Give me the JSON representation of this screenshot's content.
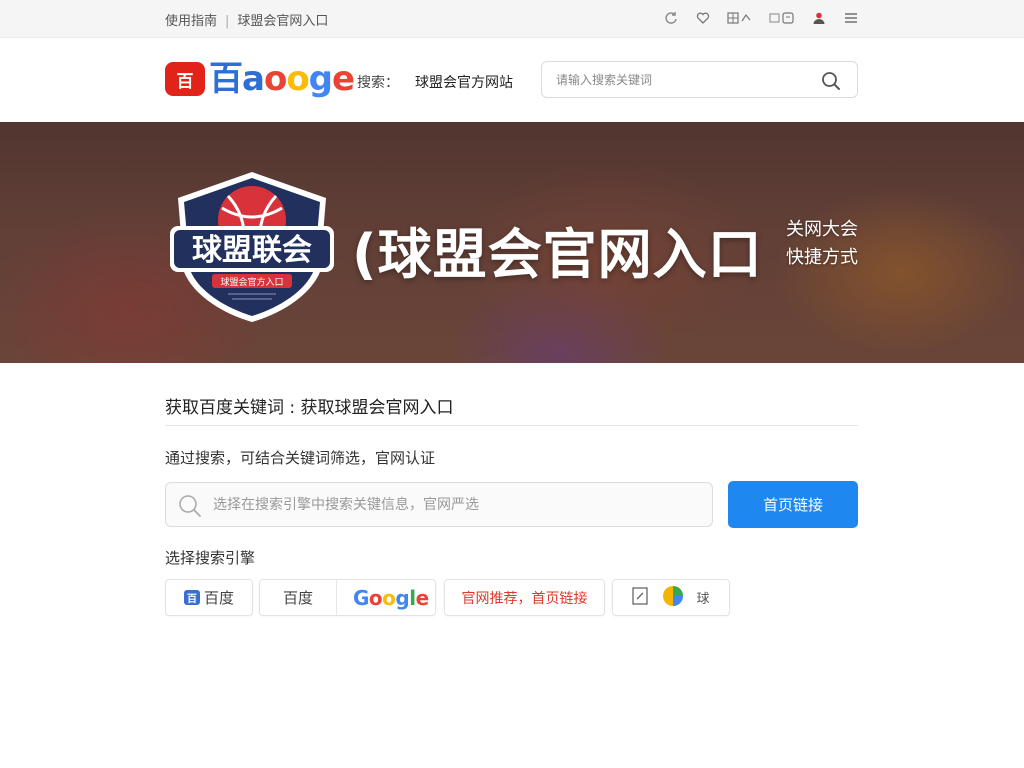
{
  "topbar": {
    "breadcrumb_left": "使用指南",
    "breadcrumb_right": "球盟会官网入口",
    "icons": [
      "refresh-icon",
      "heart-icon",
      "grid-icon",
      "share-icon",
      "user-icon",
      "menu-icon"
    ]
  },
  "header": {
    "logo_badge": "百",
    "logo_prefix": "百",
    "logo_word": "aoogle",
    "label": "搜索：",
    "site_name": "球盟会官方网站",
    "search_placeholder": "请输入搜索关键词"
  },
  "banner": {
    "crest_text": "球盟联会",
    "crest_sub": "球盟会官方入口",
    "title": "(球盟会官网入口",
    "side_line1": "关网大会",
    "side_line2": "快捷方式"
  },
  "section": {
    "title": "获取百度关键词 : 获取球盟会官网入口",
    "desc": "通过搜索，可结合关键词筛选，官网认证",
    "search_placeholder": "选择在搜索引擎中搜索关键信息，官网严选",
    "primary_button": "首页链接"
  },
  "engines": {
    "label": "选择搜索引擎",
    "items": [
      {
        "mini": "百",
        "label": "百度"
      },
      {
        "label": "百度",
        "google": "Google"
      },
      {
        "label": "官网推荐，首页链接"
      },
      {
        "label": "球"
      }
    ]
  },
  "colors": {
    "accent": "#1e88f0",
    "brand_red": "#e2231a",
    "crest_navy": "#22305e",
    "crest_red": "#d8323a"
  }
}
